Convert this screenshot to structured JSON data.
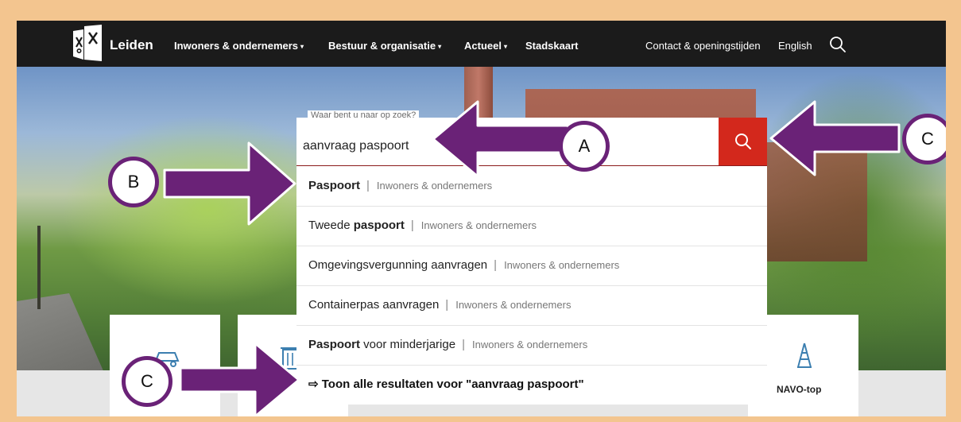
{
  "navbar": {
    "brand": "Leiden",
    "items": [
      {
        "label": "Inwoners & ondernemers",
        "caret": "▾"
      },
      {
        "label": "Bestuur & organisatie",
        "caret": "▾"
      },
      {
        "label": "Actueel",
        "caret": "▾"
      },
      {
        "label": "Stadskaart",
        "caret": ""
      }
    ],
    "contact": "Contact & openingstijden",
    "language": "English"
  },
  "search": {
    "label": "Waar bent u naar op zoek?",
    "value": "aanvraag paspoort"
  },
  "suggestions": [
    {
      "pre": "",
      "bold": "Paspoort",
      "post": "",
      "category": "Inwoners & ondernemers"
    },
    {
      "pre": "Tweede ",
      "bold": "paspoort",
      "post": "",
      "category": "Inwoners & ondernemers"
    },
    {
      "pre": "Omgevingsvergunning aanvragen",
      "bold": "",
      "post": "",
      "category": "Inwoners & ondernemers"
    },
    {
      "pre": "Containerpas aanvragen",
      "bold": "",
      "post": "",
      "category": "Inwoners & ondernemers"
    },
    {
      "pre": "",
      "bold": "Paspoort",
      "post": " voor minderjarige",
      "category": "Inwoners & ondernemers"
    }
  ],
  "separator": "|",
  "show_all": "⇨ Toon alle resultaten voor \"aanvraag paspoort\"",
  "cards": {
    "navo_label": "NAVO-top"
  },
  "annotations": {
    "a": "A",
    "b": "B",
    "c_top": "C",
    "c_bottom": "C"
  },
  "colors": {
    "annotation_purple": "#6a2277",
    "search_red": "#d3281c",
    "navbar": "#1b1b1b",
    "frame": "#f3c58f"
  }
}
